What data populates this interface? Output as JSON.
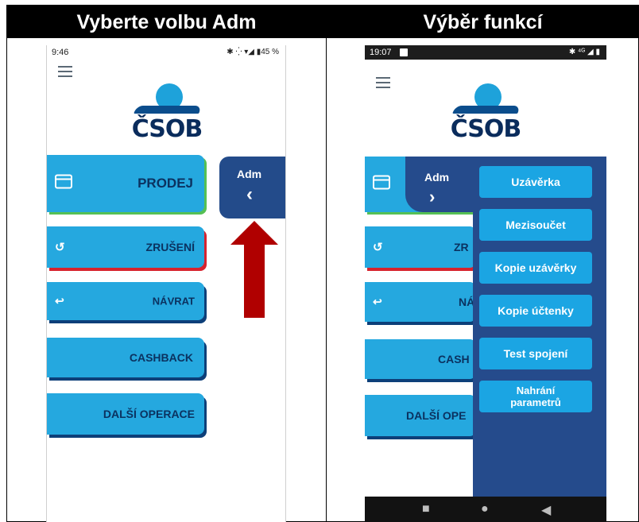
{
  "headers": {
    "left": "Vyberte volbu Adm",
    "right": "Výběr funkcí"
  },
  "phone1": {
    "status": {
      "time": "9:46",
      "right": "✱ ⁛ ▾◢ ▮45 %"
    },
    "logo_text": "ČSOB",
    "buttons": {
      "prodej": "PRODEJ",
      "zruseni": "ZRUŠENÍ",
      "navrat": "NÁVRAT",
      "cashback": "CASHBACK",
      "dalsi": "DALŠÍ OPERACE"
    },
    "adm": {
      "label": "Adm",
      "chevron": "‹"
    }
  },
  "phone2": {
    "status": {
      "time": "19:07",
      "right": "✱ ⁴ᴳ ◢ ▮"
    },
    "logo_text": "ČSOB",
    "buttons": {
      "zr": "ZR",
      "na": "NÁ",
      "cash": "CASH",
      "dalsi": "DALŠÍ OPE"
    },
    "adm": {
      "label": "Adm",
      "chevron": "›"
    },
    "menu": [
      "Uzávěrka",
      "Mezisoučet",
      "Kopie uzávěrky",
      "Kopie účtenky",
      "Test spojení",
      "Nahrání parametrů"
    ],
    "nav": {
      "square": "■",
      "circle": "●",
      "back": "◀"
    }
  },
  "colors": {
    "button_blue": "#25a8df",
    "adm_dark_blue": "#254b8c",
    "arrow_red": "#b00000",
    "green_accent": "#5cc85c",
    "red_accent": "#d7232e"
  },
  "icons": [
    "card-icon",
    "undo-icon",
    "back-arrow-icon",
    "hamburger-icon",
    "chevron-icon"
  ]
}
